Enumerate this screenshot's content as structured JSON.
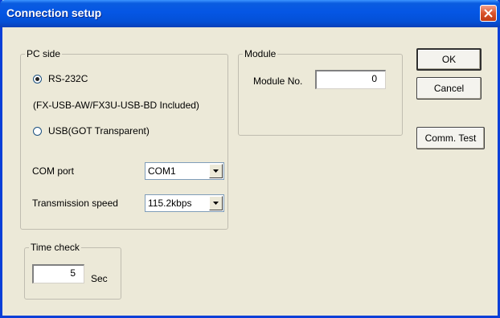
{
  "window": {
    "title": "Connection setup"
  },
  "pc_side": {
    "label": "PC side",
    "rs232c_label": "RS-232C",
    "rs232c_note": "(FX-USB-AW/FX3U-USB-BD Included)",
    "usb_label": "USB(GOT Transparent)",
    "selected": "RS-232C",
    "com_port_label": "COM port",
    "com_port_value": "COM1",
    "speed_label": "Transmission speed",
    "speed_value": "115.2kbps"
  },
  "module": {
    "label": "Module",
    "module_no_label": "Module No.",
    "module_no_value": "0"
  },
  "time_check": {
    "label": "Time check",
    "value": "5",
    "unit": "Sec"
  },
  "buttons": {
    "ok": "OK",
    "cancel": "Cancel",
    "comm_test": "Comm. Test"
  }
}
